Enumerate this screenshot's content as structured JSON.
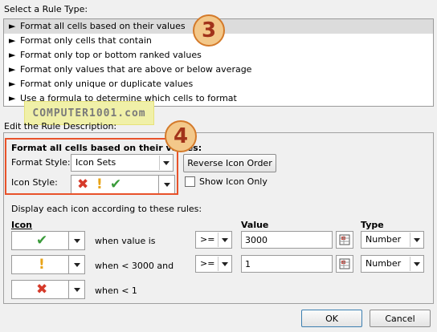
{
  "rule_type": {
    "heading": "Select a Rule Type:",
    "items": [
      {
        "label": "Format all cells based on their values"
      },
      {
        "label": "Format only cells that contain"
      },
      {
        "label": "Format only top or bottom ranked values"
      },
      {
        "label": "Format only values that are above or below average"
      },
      {
        "label": "Format only unique or duplicate values"
      },
      {
        "label": "Use a formula to determine which cells to format"
      }
    ],
    "arrow_glyph": "►"
  },
  "watermark": "COMPUTER1001.com",
  "callouts": [
    "3",
    "4"
  ],
  "description": {
    "heading": "Edit the Rule Description:",
    "subheading": "Format all cells based on their values:",
    "format_style_label": "Format Style:",
    "format_style_value": "Icon Sets",
    "reverse_button": "Reverse Icon Order",
    "icon_style_label": "Icon Style:",
    "show_icon_only_label": "Show Icon Only",
    "display_rules_label": "Display each icon according to these rules:",
    "col_icon": "Icon",
    "col_value": "Value",
    "col_type": "Type",
    "rows": [
      {
        "icon": "check-icon",
        "condition": "when value is",
        "operator": ">=",
        "value": "3000",
        "type": "Number"
      },
      {
        "icon": "exclamation-icon",
        "condition": "when < 3000 and",
        "operator": ">=",
        "value": "1",
        "type": "Number"
      },
      {
        "icon": "x-icon",
        "condition": "when < 1"
      }
    ]
  },
  "footer": {
    "ok": "OK",
    "cancel": "Cancel"
  },
  "colors": {
    "check": "#3a9b3a",
    "exclamation": "#e8a317",
    "x": "#d63a2a",
    "highlight": "#e8522a"
  }
}
